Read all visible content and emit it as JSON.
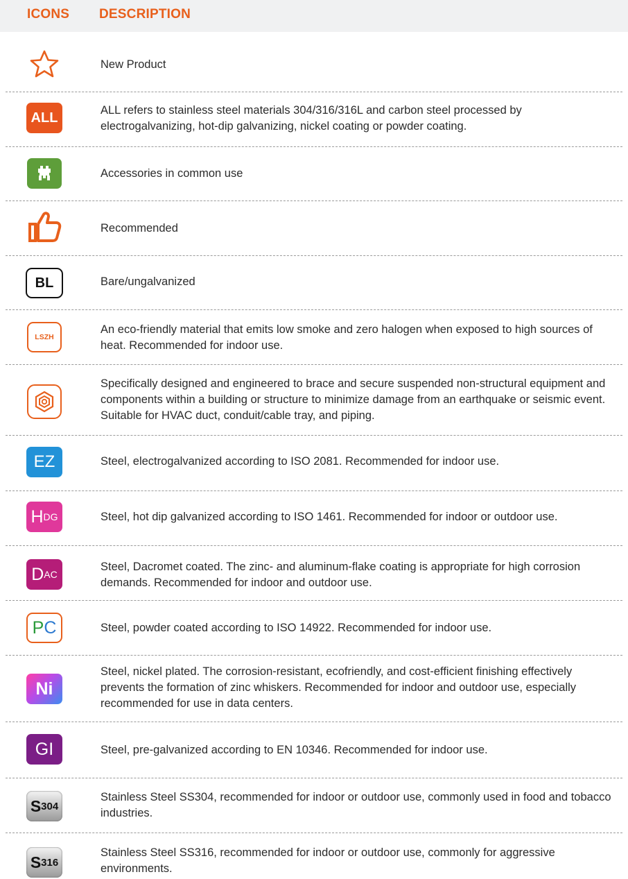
{
  "header": {
    "icons_label": "ICONS",
    "description_label": "DESCRIPTION"
  },
  "rows": [
    {
      "icon": "star-outline-icon",
      "description": "New Product"
    },
    {
      "icon": "all-badge-icon",
      "badge": "ALL",
      "description": "ALL refers to stainless steel materials 304/316/316L and carbon steel processed by electrogalvanizing, hot-dip galvanizing, nickel coating or powder coating."
    },
    {
      "icon": "accessory-badge-icon",
      "description": "Accessories in common use"
    },
    {
      "icon": "thumbs-up-icon",
      "description": "Recommended"
    },
    {
      "icon": "bl-badge-icon",
      "badge": "BL",
      "description": "Bare/ungalvanized"
    },
    {
      "icon": "lszh-badge-icon",
      "badge": "LSZH",
      "description": "An eco-friendly material that emits low smoke and zero halogen when exposed to high sources of heat. Recommended for indoor use."
    },
    {
      "icon": "seismic-badge-icon",
      "description": "Specifically designed and engineered to brace and secure suspended non-structural equipment and components within a building or structure to minimize damage from an earthquake or seismic event. Suitable for HVAC duct, conduit/cable tray, and piping."
    },
    {
      "icon": "ez-badge-icon",
      "badge": "EZ",
      "description": "Steel, electrogalvanized according to ISO 2081. Recommended for indoor use."
    },
    {
      "icon": "hdg-badge-icon",
      "badge_main": "H",
      "badge_sub": "DG",
      "description": "Steel, hot dip galvanized according to ISO 1461. Recommended for indoor or outdoor use."
    },
    {
      "icon": "dac-badge-icon",
      "badge_main": "D",
      "badge_sub": "AC",
      "description": "Steel, Dacromet coated. The zinc- and aluminum-flake coating is appropriate for high corrosion demands. Recommended for indoor and outdoor use."
    },
    {
      "icon": "pc-badge-icon",
      "badge_p": "P",
      "badge_c": "C",
      "description": "Steel, powder coated according to ISO 14922. Recommended for indoor use."
    },
    {
      "icon": "ni-badge-icon",
      "badge": "Ni",
      "description": "Steel, nickel plated. The corrosion-resistant, ecofriendly, and cost-efficient finishing effectively prevents the formation of zinc whiskers. Recommended for indoor and outdoor use, especially recommended for use in data centers."
    },
    {
      "icon": "gi-badge-icon",
      "badge": "GI",
      "description": "Steel, pre-galvanized according to EN 10346. Recommended for indoor use."
    },
    {
      "icon": "ss304-badge-icon",
      "badge_main": "S",
      "badge_sub": "304",
      "description": "Stainless Steel SS304, recommended for indoor or outdoor use, commonly used in food and tobacco industries."
    },
    {
      "icon": "ss316-badge-icon",
      "badge_main": "S",
      "badge_sub": "316",
      "description": "Stainless Steel SS316, recommended for indoor or outdoor use, commonly for aggressive environments."
    }
  ],
  "colors": {
    "accent": "#e8601c",
    "header_bg": "#f0f1f2",
    "divider": "#9a9a9a"
  }
}
